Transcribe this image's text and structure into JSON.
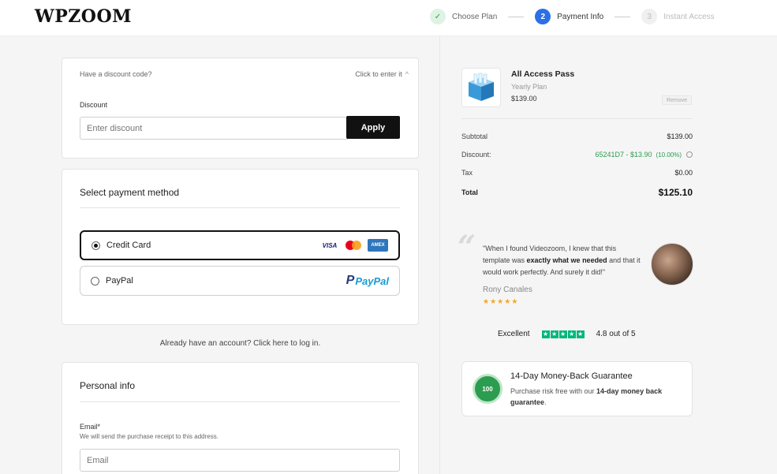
{
  "brand": {
    "logo": "WPZOOM"
  },
  "steps": [
    {
      "number": "",
      "label": "Choose Plan",
      "state": "done"
    },
    {
      "number": "2",
      "label": "Payment Info",
      "state": "active"
    },
    {
      "number": "3",
      "label": "Instant Access",
      "state": "idle"
    }
  ],
  "discount": {
    "prompt": "Have a discount code?",
    "toggle_label": "Click to enter it",
    "field_label": "Discount",
    "placeholder": "Enter discount",
    "apply_label": "Apply"
  },
  "payment": {
    "title": "Select payment method",
    "methods": [
      {
        "label": "Credit Card",
        "selected": true
      },
      {
        "label": "PayPal",
        "selected": false
      }
    ],
    "card_brands": [
      "VISA",
      "AMEX"
    ],
    "paypal_brand": "PayPal"
  },
  "login_prompt": "Already have an account? Click here to log in.",
  "personal": {
    "title": "Personal info",
    "email_label": "Email*",
    "email_hint": "We will send the purchase receipt to this address.",
    "email_placeholder": "Email"
  },
  "order": {
    "product_name": "All Access Pass",
    "plan": "Yearly Plan",
    "price": "$139.00",
    "remove_label": "Remove",
    "rows": {
      "subtotal_label": "Subtotal",
      "subtotal_value": "$139.00",
      "discount_label": "Discount:",
      "discount_value": "65241D7 - $13.90",
      "discount_pct": "(10.00%)",
      "tax_label": "Tax",
      "tax_value": "$0.00",
      "total_label": "Total",
      "total_value": "$125.10"
    }
  },
  "testimonial": {
    "quote_before": "\"When I found Videozoom, I knew that this template was ",
    "quote_bold": "exactly what we needed",
    "quote_after": " and that it would work perfectly. And surely it did!\"",
    "author": "Rony Canales",
    "rating_stars": 5
  },
  "trust": {
    "label": "Excellent",
    "score": "4.8 out of 5"
  },
  "guarantee": {
    "title": "14-Day Money-Back Guarantee",
    "text_before": "Purchase risk free with our ",
    "text_bold": "14-day money back guarantee",
    "text_after": ".",
    "badge_text": "100"
  },
  "colors": {
    "accent": "#2c6fe6",
    "success": "#2c9c4f",
    "dark": "#111111",
    "trustpilot": "#00b67a",
    "star": "#f5a623"
  }
}
